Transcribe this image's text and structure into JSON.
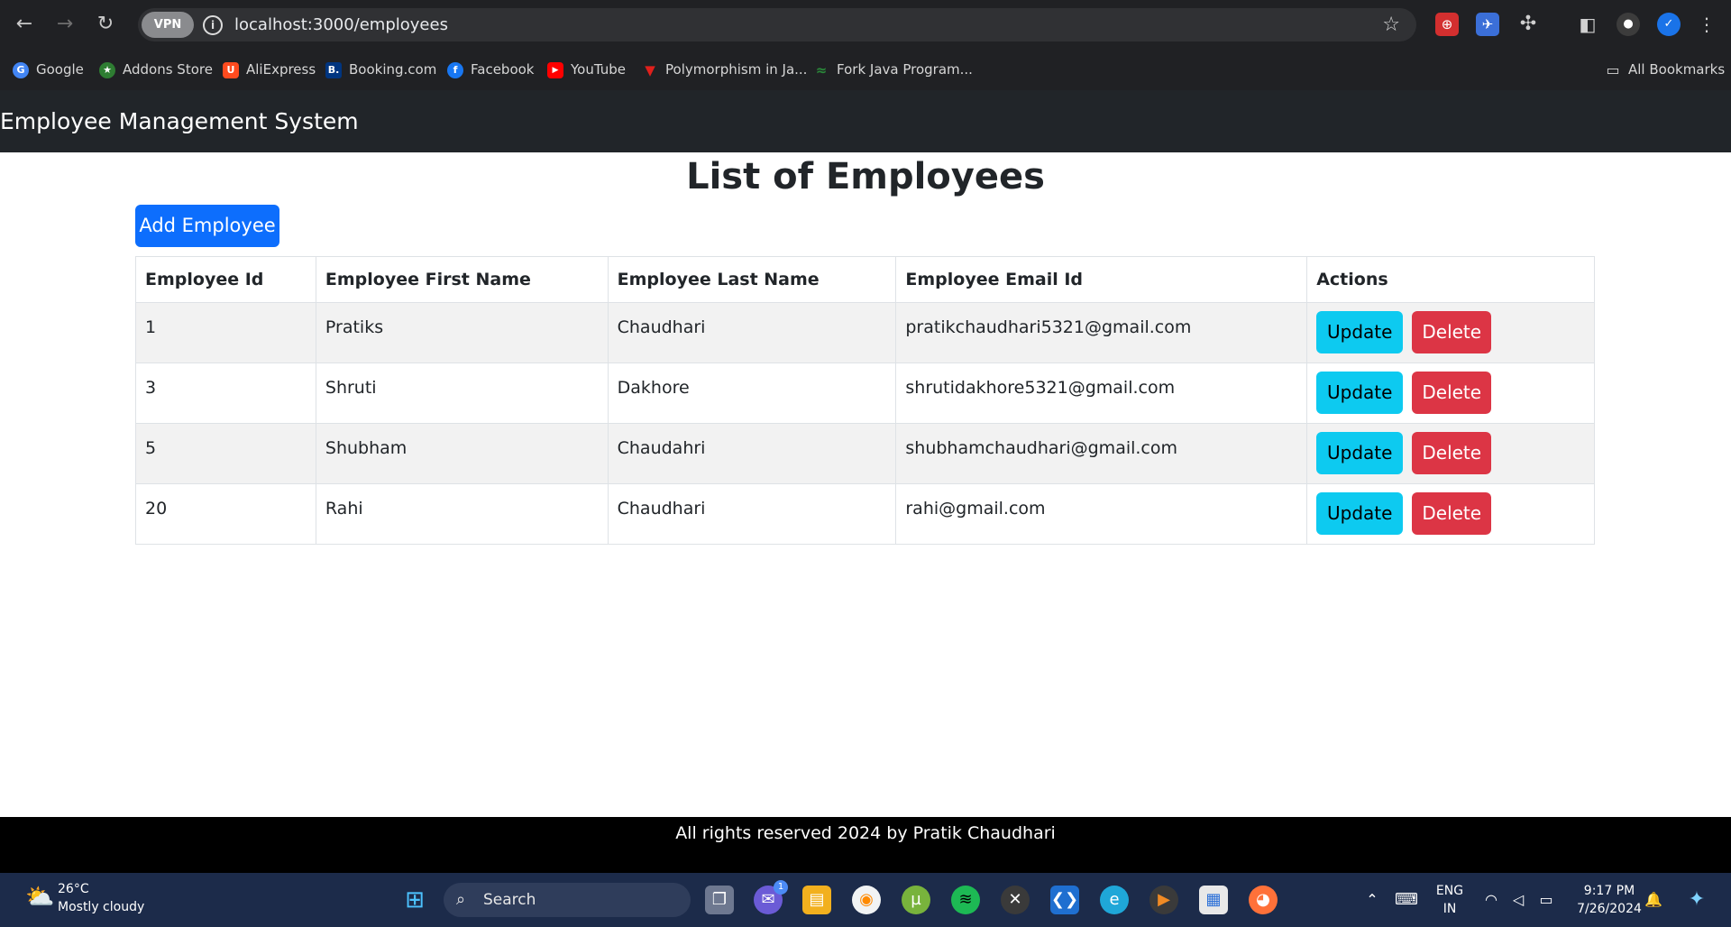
{
  "browser": {
    "url": "localhost:3000/employees",
    "vpn_label": "VPN",
    "bookmarks": [
      {
        "label": "Google",
        "color": "#4285f4",
        "glyph": "G"
      },
      {
        "label": "Addons Store",
        "color": "#2e7d32",
        "glyph": "★"
      },
      {
        "label": "AliExpress",
        "color": "#ff4b1f",
        "glyph": "U"
      },
      {
        "label": "Booking.com",
        "color": "#003580",
        "glyph": "B."
      },
      {
        "label": "Facebook",
        "color": "#1877f2",
        "glyph": "f"
      },
      {
        "label": "YouTube",
        "color": "#ff0000",
        "glyph": "▶"
      },
      {
        "label": "Polymorphism in Ja...",
        "color": "#e0201c",
        "glyph": "▼"
      },
      {
        "label": "Fork Java Program...",
        "color": "#2a8a3a",
        "glyph": "≈"
      }
    ],
    "all_bookmarks_label": "All Bookmarks"
  },
  "app": {
    "brand": "Employee Management System",
    "page_title": "List of Employees",
    "add_button_label": "Add Employee",
    "table": {
      "headers": [
        "Employee Id",
        "Employee First Name",
        "Employee Last Name",
        "Employee Email Id",
        "Actions"
      ],
      "rows": [
        {
          "id": "1",
          "first": "Pratiks",
          "last": "Chaudhari",
          "email": "pratikchaudhari5321@gmail.com"
        },
        {
          "id": "3",
          "first": "Shruti",
          "last": "Dakhore",
          "email": "shrutidakhore5321@gmail.com"
        },
        {
          "id": "5",
          "first": "Shubham",
          "last": "Chaudahri",
          "email": "shubhamchaudhari@gmail.com"
        },
        {
          "id": "20",
          "first": "Rahi",
          "last": "Chaudhari",
          "email": "rahi@gmail.com"
        }
      ],
      "update_label": "Update",
      "delete_label": "Delete"
    },
    "footer_text": "All rights reserved 2024 by Pratik Chaudhari",
    "colors": {
      "primary": "#0d6efd",
      "info": "#0dcaf0",
      "danger": "#dc3545",
      "header_bg": "#212529"
    }
  },
  "taskbar": {
    "temperature": "26°C",
    "weather": "Mostly cloudy",
    "search_label": "Search",
    "chat_badge": "1",
    "lang_top": "ENG",
    "lang_bottom": "IN",
    "time": "9:17 PM",
    "date": "7/26/2024"
  }
}
